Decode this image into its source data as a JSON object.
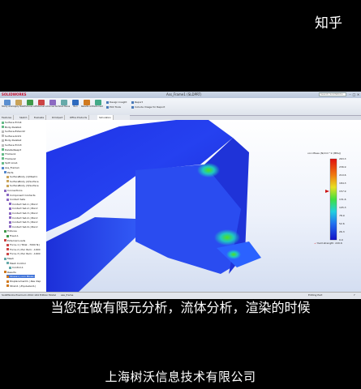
{
  "watermark": "知乎",
  "app": {
    "logo": "SOLIDWORKS",
    "window_title": "Ass_Frame1 (SLDPRT)",
    "search_placeholder": "Search SolidWorks Help",
    "ribbon": {
      "buttons": [
        {
          "label": "Study Advisor",
          "icon": "study-advisor-icon",
          "color": "#5b8fd0"
        },
        {
          "label": "Apply Material",
          "icon": "material-icon",
          "color": "#c9a35a"
        },
        {
          "label": "Fixtures Advisor",
          "icon": "fixture-icon",
          "color": "#3f9a4a"
        },
        {
          "label": "External Loads",
          "icon": "load-icon",
          "color": "#c44"
        },
        {
          "label": "Connections Advisor",
          "icon": "connection-icon",
          "color": "#8c6ac2"
        },
        {
          "label": "Shell Manager",
          "icon": "shell-icon",
          "color": "#6aa"
        },
        {
          "label": "Run",
          "icon": "run-icon",
          "color": "#2e6bbf"
        },
        {
          "label": "Results Advisor",
          "icon": "results-icon",
          "color": "#d07a20"
        },
        {
          "label": "Deformed Result",
          "icon": "deformed-icon",
          "color": "#4a8"
        }
      ],
      "small_items": [
        "Design Insight",
        "Plot Tools",
        "Report",
        "Include Image for Report"
      ]
    },
    "tabs": [
      "Features",
      "Sketch",
      "Evaluate",
      "DimXpert",
      "Office Products",
      "Simulation"
    ],
    "active_tab": "Simulation",
    "tree": [
      {
        "label": "Surface-Trim4",
        "indent": 0,
        "color": "#6b8"
      },
      {
        "label": "Body-Delete1",
        "indent": 0,
        "color": "#6b8"
      },
      {
        "label": "Surface-Extend2",
        "indent": 0,
        "color": "#bbb"
      },
      {
        "label": "Surface-Knit1",
        "indent": 0,
        "color": "#bbb"
      },
      {
        "label": "Body-Delete2",
        "indent": 0,
        "color": "#bbb"
      },
      {
        "label": "Surface-Trim3",
        "indent": 0,
        "color": "#bbb"
      },
      {
        "label": "Delete/Keep3",
        "indent": 0,
        "color": "#6b8"
      },
      {
        "label": "Thicken1",
        "indent": 0,
        "color": "#6b8"
      },
      {
        "label": "Thicken2",
        "indent": 0,
        "color": "#6b8"
      },
      {
        "label": "Split Line1",
        "indent": 0,
        "color": "#6b8"
      },
      {
        "label": "Ass_Frame1",
        "indent": 0,
        "color": "#58c"
      },
      {
        "label": "Parts",
        "indent": 1,
        "color": "#58c"
      },
      {
        "label": "SurfaceBody (1)Mesh1",
        "indent": 2,
        "color": "#c9a35a"
      },
      {
        "label": "SurfaceBody (2)Surface",
        "indent": 2,
        "color": "#c9a35a"
      },
      {
        "label": "SurfaceBody (3)Surface",
        "indent": 2,
        "color": "#c9a35a"
      },
      {
        "label": "Connections",
        "indent": 1,
        "color": "#8c6ac2"
      },
      {
        "label": "Component Contacts",
        "indent": 2,
        "color": "#8c6ac2"
      },
      {
        "label": "Contact Sets",
        "indent": 2,
        "color": "#8c6ac2"
      },
      {
        "label": "Contact Set-1 (-Bond",
        "indent": 3,
        "color": "#8c6ac2"
      },
      {
        "label": "Contact Set-2 (-Bond",
        "indent": 3,
        "color": "#8c6ac2"
      },
      {
        "label": "Contact Set-3 (-Bond",
        "indent": 3,
        "color": "#8c6ac2"
      },
      {
        "label": "Contact Set-4 (-Bond",
        "indent": 3,
        "color": "#8c6ac2"
      },
      {
        "label": "Contact Set-5 (-Bond",
        "indent": 3,
        "color": "#8c6ac2"
      },
      {
        "label": "Contact Set-6 (-Bond",
        "indent": 3,
        "color": "#8c6ac2"
      },
      {
        "label": "Fixtures",
        "indent": 1,
        "color": "#3f9a4a"
      },
      {
        "label": "Fixed-1",
        "indent": 2,
        "color": "#3f9a4a"
      },
      {
        "label": "External Loads",
        "indent": 1,
        "color": "#c44"
      },
      {
        "label": "Force-1 (:Total: -7000 N:)",
        "indent": 2,
        "color": "#c44"
      },
      {
        "label": "Force-2 (:Per Item: -1000",
        "indent": 2,
        "color": "#c44"
      },
      {
        "label": "Force-3 (:Per Item: -1000",
        "indent": 2,
        "color": "#c44"
      },
      {
        "label": "Mesh",
        "indent": 1,
        "color": "#6aa"
      },
      {
        "label": "Mesh Control",
        "indent": 2,
        "color": "#6aa"
      },
      {
        "label": "Control-1",
        "indent": 3,
        "color": "#6aa"
      },
      {
        "label": "Results",
        "indent": 1,
        "color": "#d07a20"
      },
      {
        "label": "Stress1 (-von Mises-)",
        "indent": 2,
        "color": "#d07a20",
        "selected": true
      },
      {
        "label": "Displacement1 (-Res disp",
        "indent": 2,
        "color": "#d07a20"
      },
      {
        "label": "Strain1 (-Equivalent-)",
        "indent": 2,
        "color": "#d07a20"
      }
    ],
    "legend": {
      "title": "von Mises (N/mm^2 (MPa))",
      "values": [
        "263.3",
        "236.9",
        "210.6",
        "184.3",
        "157.9",
        "131.6",
        "105.3",
        "78.9",
        "52.6",
        "26.3",
        "0.0"
      ],
      "yield_label": "Yield strength: 220.6"
    },
    "status": {
      "left": "SolidWorks Premium 2012 x64 Edition",
      "tabs": [
        "Model",
        "ass_frame"
      ],
      "editing": "Editing Part",
      "help": "?"
    }
  },
  "subtitle": "当您在做有限元分析，流体分析，渲染的时候",
  "company": "上海树沃信息技术有限公司"
}
